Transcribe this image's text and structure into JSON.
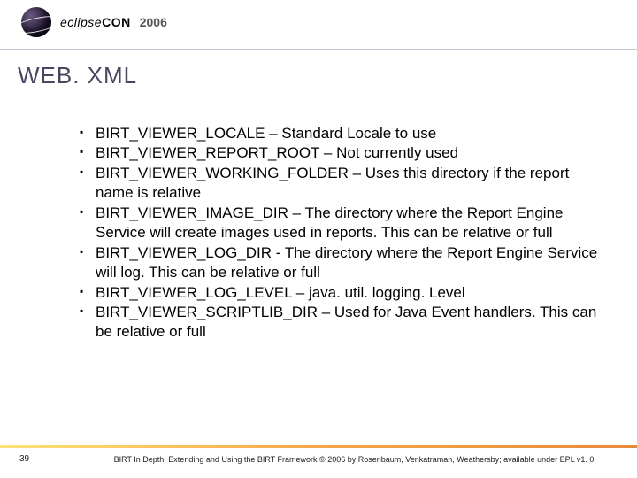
{
  "header": {
    "brand_eclipse": "eclipse",
    "brand_con": "CON",
    "year": "2006"
  },
  "title": "WEB. XML",
  "bullets": [
    "BIRT_VIEWER_LOCALE – Standard Locale to use",
    "BIRT_VIEWER_REPORT_ROOT – Not currently used",
    "BIRT_VIEWER_WORKING_FOLDER – Uses this directory if the report name is relative",
    "BIRT_VIEWER_IMAGE_DIR – The directory where the Report Engine Service will create images used in reports.  This can be relative or full",
    "BIRT_VIEWER_LOG_DIR - The directory where the Report Engine Service will log.  This can be relative or full",
    "BIRT_VIEWER_LOG_LEVEL – java. util. logging. Level",
    "BIRT_VIEWER_SCRIPTLIB_DIR – Used for Java Event handlers. This can be relative or full"
  ],
  "footer": {
    "page": "39",
    "text": "BIRT In Depth: Extending and Using the BIRT Framework © 2006 by Rosenbaum, Venkatraman, Weathersby; available under EPL v1. 0"
  }
}
